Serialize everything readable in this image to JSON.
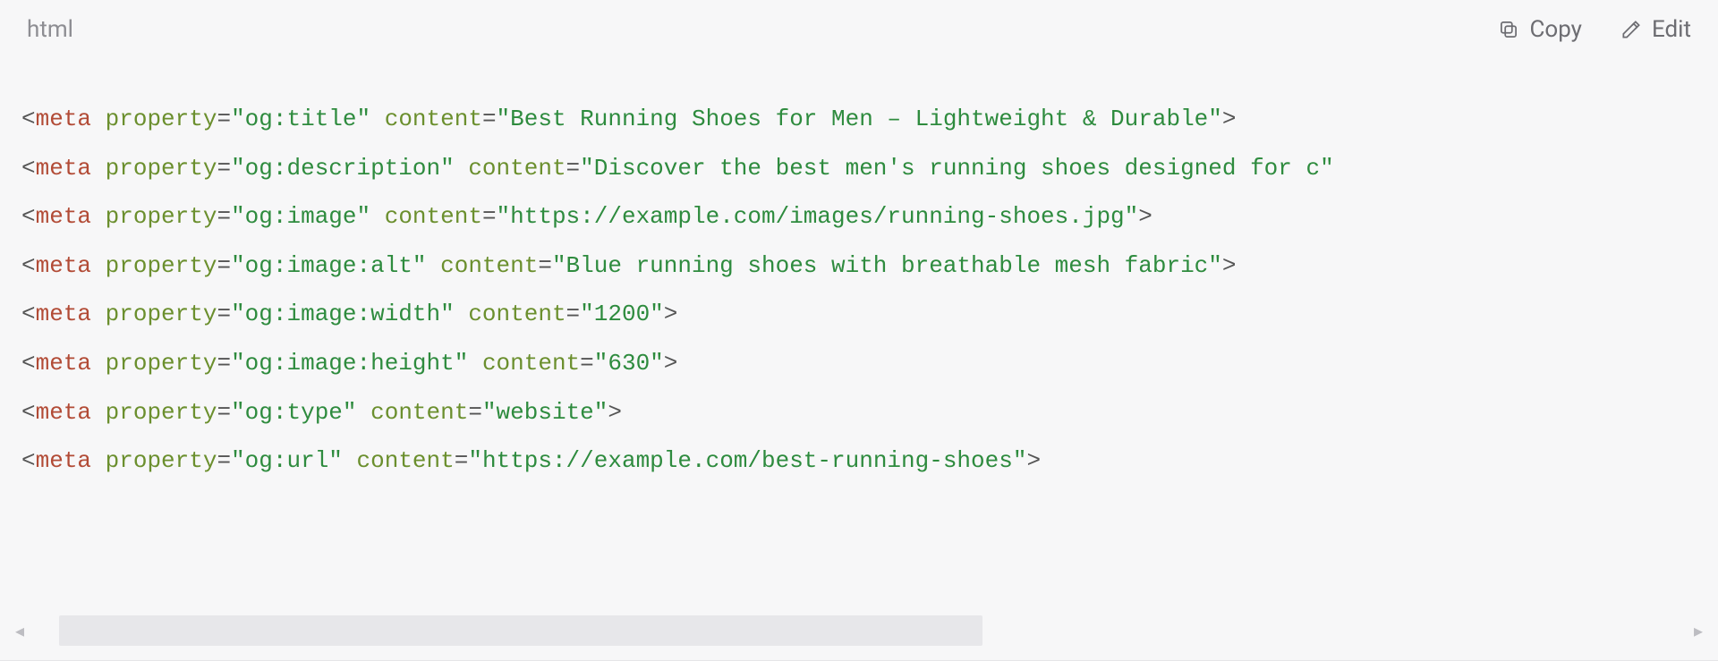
{
  "header": {
    "language": "html",
    "copy_label": "Copy",
    "edit_label": "Edit"
  },
  "code": {
    "lines": [
      {
        "tag": "meta",
        "attr1": "property",
        "val1": "og:title",
        "attr2": "content",
        "val2": "Best Running Shoes for Men – Lightweight & Durable"
      },
      {
        "tag": "meta",
        "attr1": "property",
        "val1": "og:description",
        "attr2": "content",
        "val2": "Discover the best men's running shoes designed for c"
      },
      {
        "tag": "meta",
        "attr1": "property",
        "val1": "og:image",
        "attr2": "content",
        "val2": "https://example.com/images/running-shoes.jpg"
      },
      {
        "tag": "meta",
        "attr1": "property",
        "val1": "og:image:alt",
        "attr2": "content",
        "val2": "Blue running shoes with breathable mesh fabric"
      },
      {
        "tag": "meta",
        "attr1": "property",
        "val1": "og:image:width",
        "attr2": "content",
        "val2": "1200"
      },
      {
        "tag": "meta",
        "attr1": "property",
        "val1": "og:image:height",
        "attr2": "content",
        "val2": "630"
      },
      {
        "tag": "meta",
        "attr1": "property",
        "val1": "og:type",
        "attr2": "content",
        "val2": "website"
      },
      {
        "tag": "meta",
        "attr1": "property",
        "val1": "og:url",
        "attr2": "content",
        "val2": "https://example.com/best-running-shoes"
      }
    ]
  },
  "scrollbar": {
    "thumb_left_pct": 1.5,
    "thumb_width_pct": 56
  }
}
